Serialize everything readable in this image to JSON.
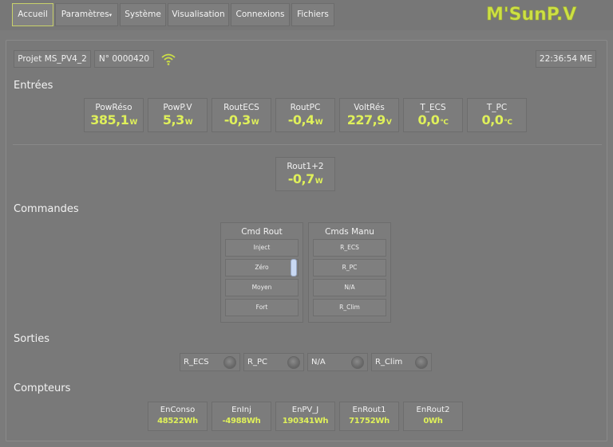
{
  "nav": {
    "accueil": "Accueil",
    "parametres": "Paramètres",
    "systeme": "Système",
    "visualisation": "Visualisation",
    "connexions": "Connexions",
    "fichiers": "Fichiers"
  },
  "logo": {
    "text": "M'SunPV",
    "color": "#cde045"
  },
  "header": {
    "project": "Projet MS_PV4_2",
    "serial": "N° 0000420",
    "clock": "22:36:54 ME",
    "wifi_icon": "wifi-icon"
  },
  "entrees": {
    "title": "Entrées",
    "cards": [
      {
        "label": "PowRéso",
        "value": "385,1",
        "unit": "W"
      },
      {
        "label": "PowP.V",
        "value": "5,3",
        "unit": "W"
      },
      {
        "label": "RoutECS",
        "value": "-0,3",
        "unit": "W"
      },
      {
        "label": "RoutPC",
        "value": "-0,4",
        "unit": "W"
      },
      {
        "label": "VoltRés",
        "value": "227,9",
        "unit": "V"
      },
      {
        "label": "T_ECS",
        "value": "0,0",
        "unit": "°C"
      },
      {
        "label": "T_PC",
        "value": "0,0",
        "unit": "°C"
      }
    ],
    "extra": {
      "label": "Rout1+2",
      "value": "-0,7",
      "unit": "W"
    }
  },
  "commandes": {
    "title": "Commandes",
    "rout": {
      "header": "Cmd Rout",
      "options": [
        "Inject",
        "Zéro",
        "Moyen",
        "Fort"
      ],
      "selected_index": 1
    },
    "manu": {
      "header": "Cmds Manu",
      "options": [
        "R_ECS",
        "R_PC",
        "N/A",
        "R_Clim"
      ]
    }
  },
  "sorties": {
    "title": "Sorties",
    "items": [
      "R_ECS",
      "R_PC",
      "N/A",
      "R_Clim"
    ]
  },
  "compteurs": {
    "title": "Compteurs",
    "items": [
      {
        "label": "EnConso",
        "value": "48522Wh"
      },
      {
        "label": "EnInj",
        "value": "-4988Wh"
      },
      {
        "label": "EnPV_J",
        "value": "190341Wh"
      },
      {
        "label": "EnRout1",
        "value": "71752Wh"
      },
      {
        "label": "EnRout2",
        "value": "0Wh"
      }
    ]
  },
  "colors": {
    "value_green": "#dff05a",
    "background": "#7b7b7b",
    "slider_knob": "#c9d9f3"
  }
}
